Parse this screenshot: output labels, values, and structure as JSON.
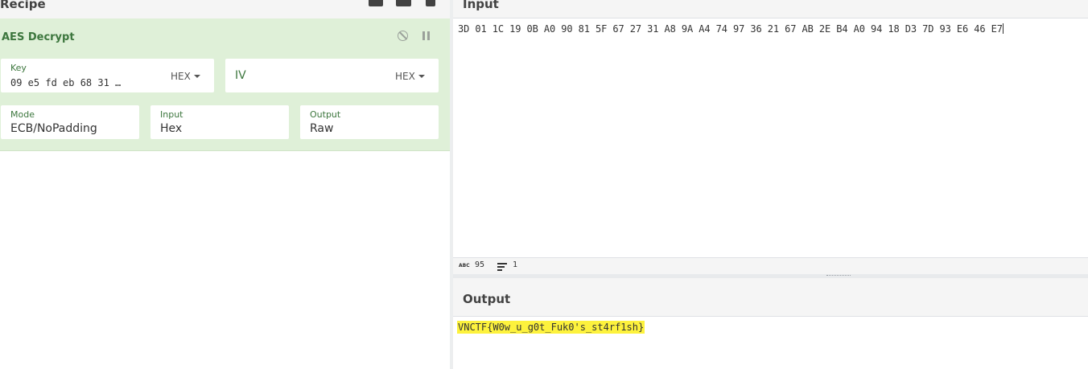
{
  "recipe": {
    "title": "Recipe",
    "header_icons": [
      "save-icon",
      "folder-icon",
      "trash-icon"
    ]
  },
  "operation": {
    "name": "AES Decrypt",
    "key": {
      "label": "Key",
      "value": "09 e5 fd eb 68 31 …",
      "format": "HEX"
    },
    "iv": {
      "placeholder": "IV",
      "format": "HEX"
    },
    "mode": {
      "label": "Mode",
      "value": "ECB/NoPadding"
    },
    "input": {
      "label": "Input",
      "value": "Hex"
    },
    "output": {
      "label": "Output",
      "value": "Raw"
    },
    "colors": {
      "background": "#dff0d8",
      "accent": "#3c763d"
    }
  },
  "input_pane": {
    "title": "Input",
    "text": "3D 01 1C 19 0B A0 90 81 5F 67 27 31 A8 9A A4 74 97 36 21 67 AB 2E B4 A0 94 18 D3 7D 93 E6 46 E7",
    "status": {
      "abc_label": "ABC",
      "char_count": "95",
      "line_count": "1"
    }
  },
  "output_pane": {
    "title": "Output",
    "text": "VNCTF{W0w_u_g0t_Fuk0's_st4rf1sh}",
    "highlight_color": "#fdf23d"
  }
}
